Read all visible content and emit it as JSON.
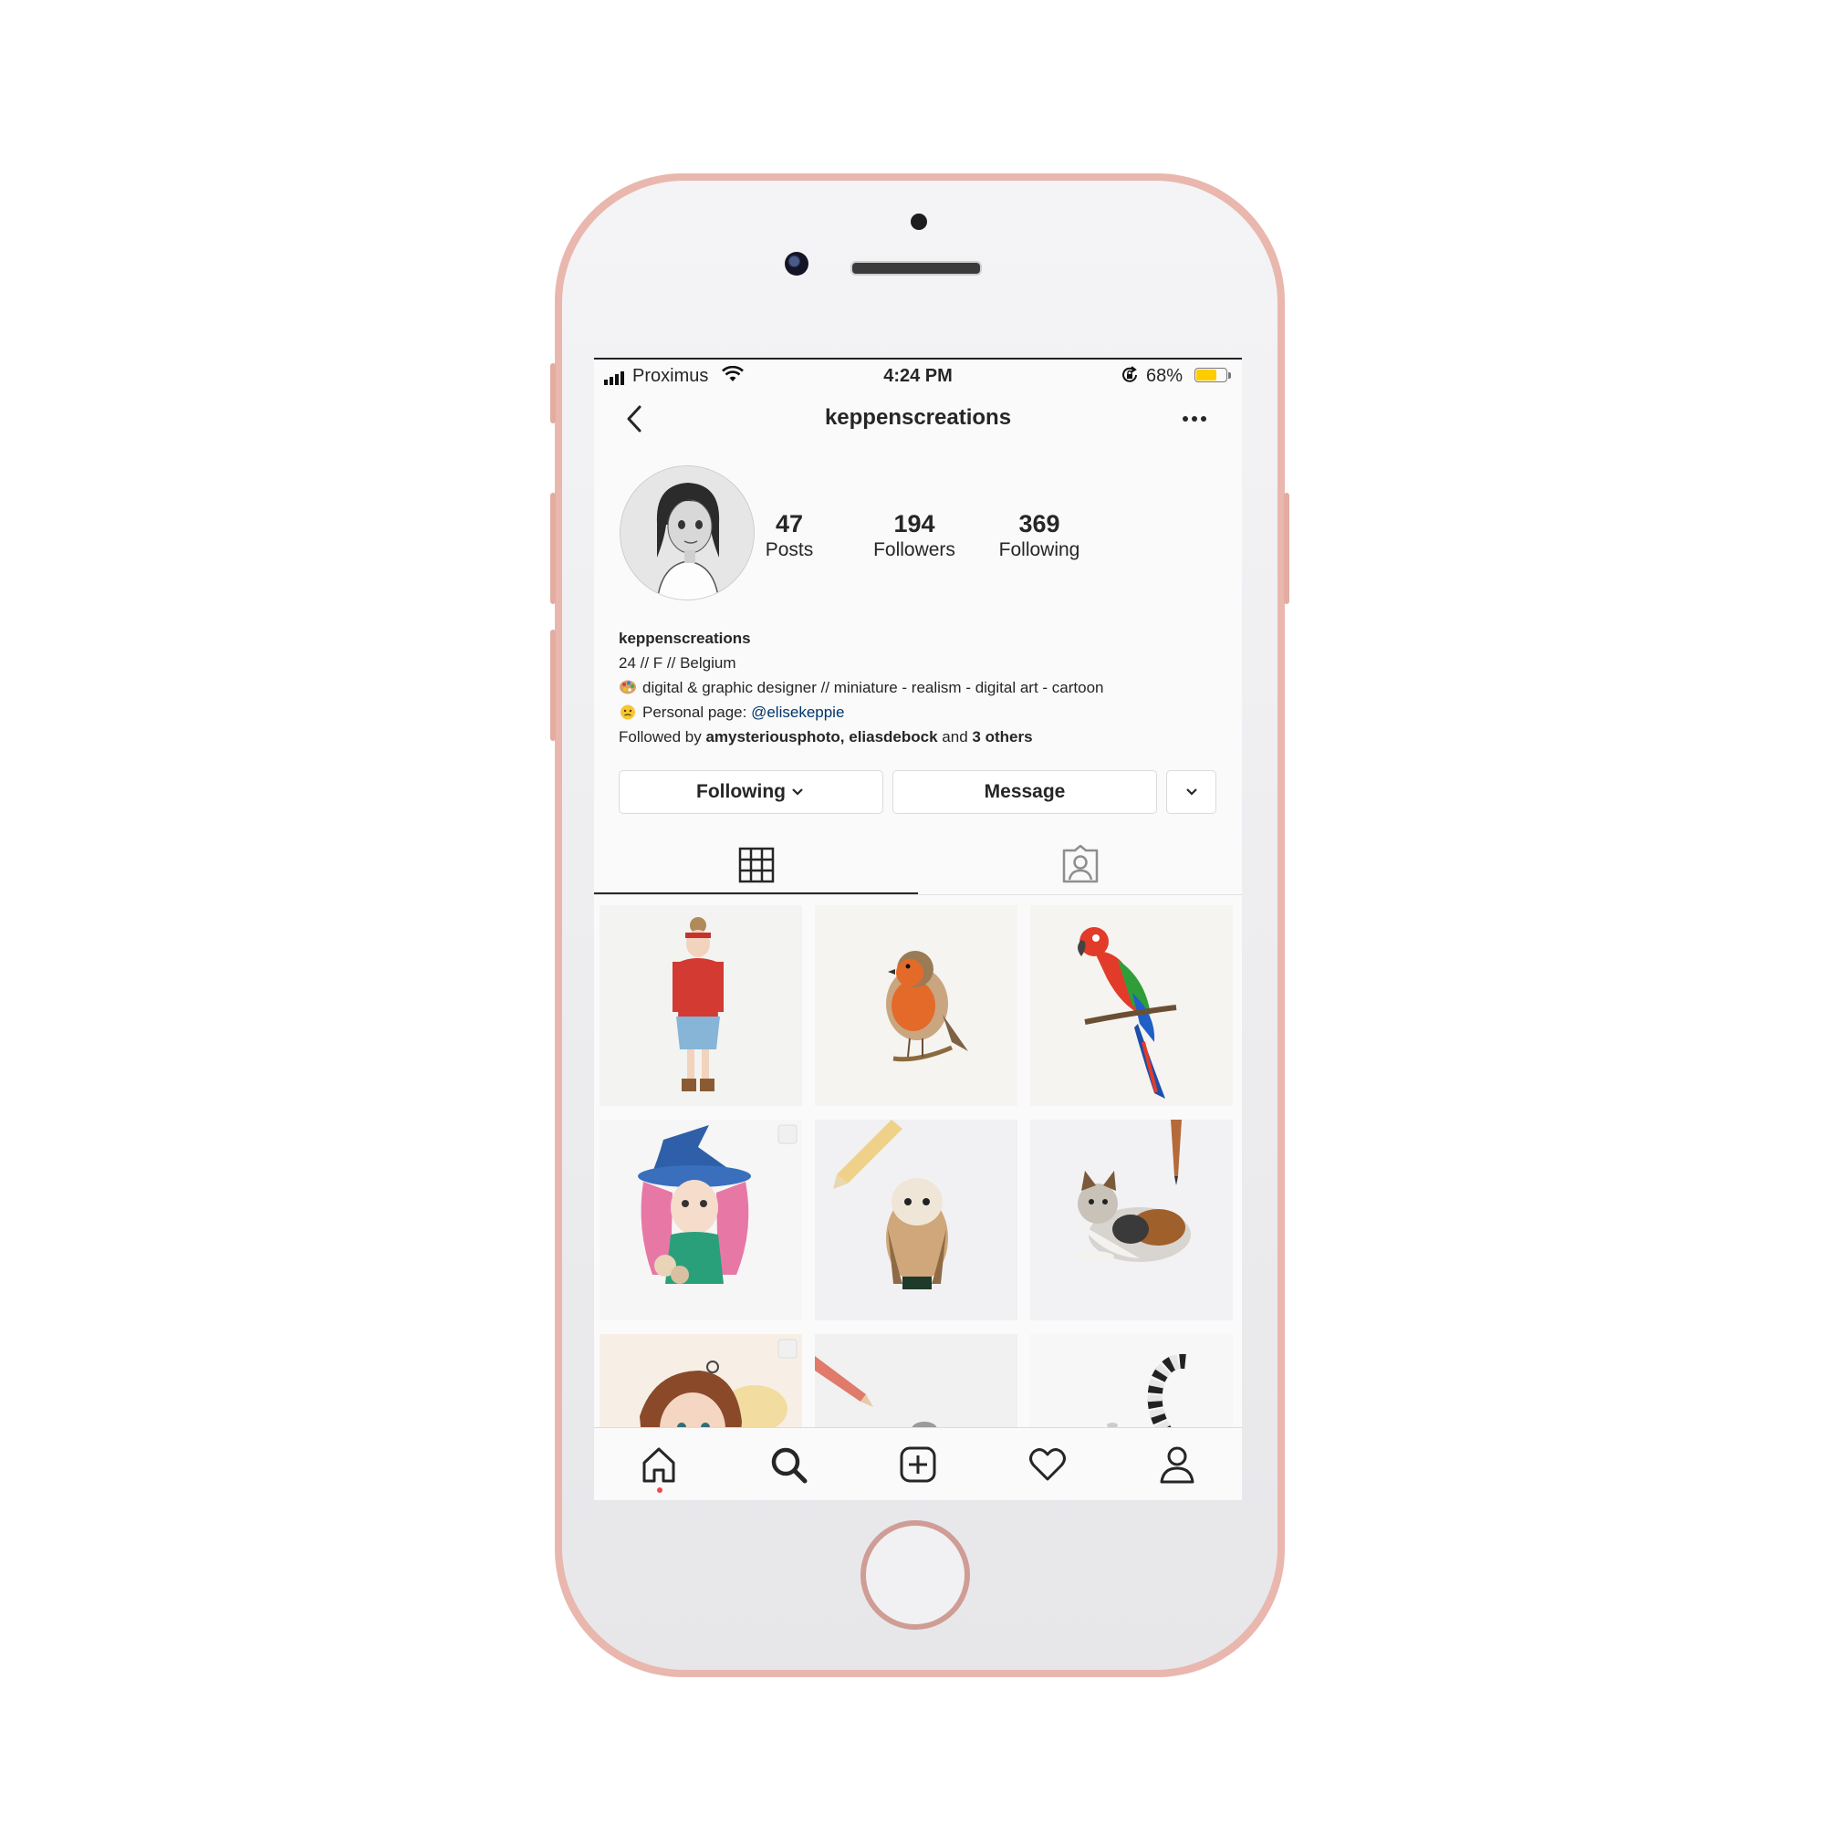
{
  "status_bar": {
    "carrier": "Proximus",
    "time": "4:24 PM",
    "battery": "68%",
    "battery_level": 0.68,
    "battery_color": "#ffcc00"
  },
  "header": {
    "username": "keppenscreations"
  },
  "stats": {
    "posts": {
      "value": "47",
      "label": "Posts"
    },
    "followers": {
      "value": "194",
      "label": "Followers"
    },
    "following": {
      "value": "369",
      "label": "Following"
    }
  },
  "bio": {
    "name": "keppenscreations",
    "line1": "24 // F // Belgium",
    "line2": "digital & graphic designer // miniature - realism - digital art - cartoon",
    "line3_prefix": "Personal page: ",
    "line3_mention": "@elisekeppie",
    "followed_by_prefix": "Followed by ",
    "followed_by_users": "amysteriousphoto, eliasdebock",
    "followed_by_and": " and ",
    "followed_by_others": "3 others",
    "mention_color": "#003569"
  },
  "actions": {
    "following_label": "Following",
    "message_label": "Message"
  },
  "tabs": [
    "grid",
    "tagged"
  ],
  "posts": [
    "girl-red-sweater-drawing",
    "robin-drawing",
    "parrot-drawing",
    "witch-girl-drawing",
    "barn-owl-drawing",
    "calico-cat-drawing",
    "brown-haired-girl-drawing",
    "pencil-sketch-drawing",
    "lemur-tail-drawing"
  ],
  "bottom_nav": [
    "home",
    "search",
    "new-post",
    "activity",
    "profile"
  ],
  "accent_color": "#ed4956"
}
